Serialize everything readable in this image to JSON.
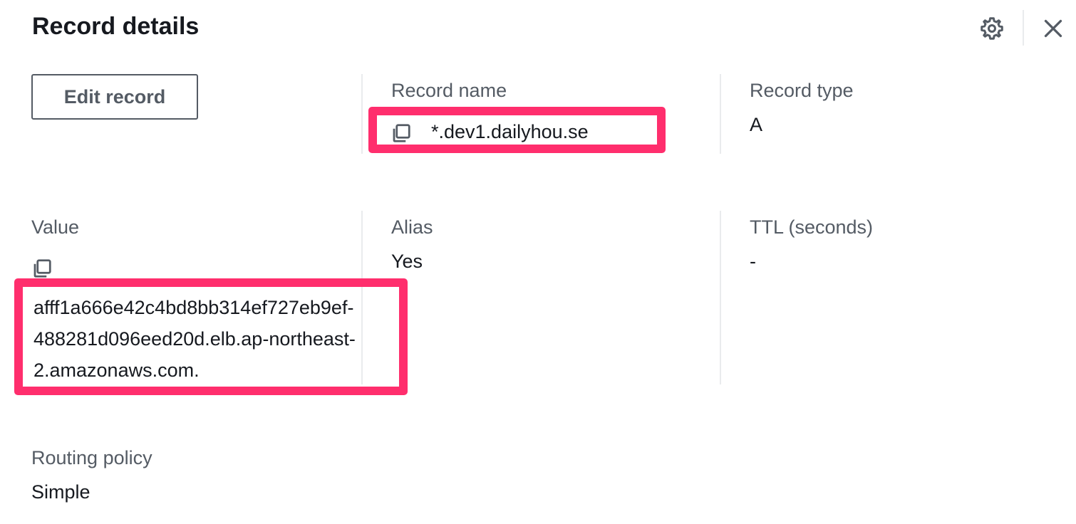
{
  "header": {
    "title": "Record details",
    "settings_icon": "gear-icon",
    "close_icon": "close-icon"
  },
  "actions": {
    "edit_label": "Edit record"
  },
  "fields": {
    "record_name": {
      "label": "Record name",
      "value": "*.dev1.dailyhou.se",
      "copy_icon": "copy-icon"
    },
    "record_type": {
      "label": "Record type",
      "value": "A"
    },
    "value": {
      "label": "Value",
      "copy_icon": "copy-icon",
      "lines": [
        "afff1a666e42c4bd8bb314ef727eb9ef-",
        "488281d096eed20d.elb.ap-northeast-",
        "2.amazonaws.com."
      ]
    },
    "alias": {
      "label": "Alias",
      "value": "Yes"
    },
    "ttl": {
      "label": "TTL (seconds)",
      "value": "-"
    },
    "routing_policy": {
      "label": "Routing policy",
      "value": "Simple"
    }
  },
  "colors": {
    "highlight": "#ff2e6d",
    "label": "#545b64",
    "text": "#16191f",
    "divider": "#e9ebed"
  }
}
